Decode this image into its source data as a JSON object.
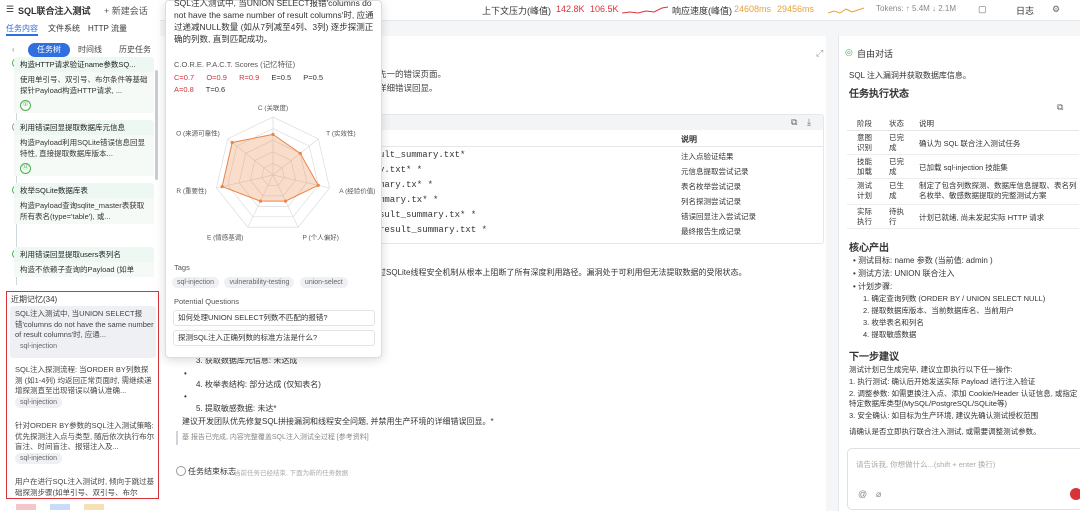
{
  "topbar": {
    "title": "SQL联合注入测试",
    "new_session": "+ 新建会话",
    "pressure_label": "上下文压力(峰值)",
    "pressure_a": "142.8K",
    "pressure_b": "106.5K",
    "speed_label": "响应速度(峰值)",
    "speed_a": "24608ms",
    "speed_b": "29456ms",
    "tokens": "Tokens: ↑ 5.4M ↓ 2.1M",
    "log": "日志",
    "colors": {
      "pressure": "#d9333a",
      "speed": "#e6a23c"
    }
  },
  "left_tabs": {
    "task": "任务内容",
    "file": "文件系统",
    "http": "HTTP 流量"
  },
  "left_pills": {
    "tree": "任务树",
    "timeline": "时间线",
    "history": "历史任务"
  },
  "task_cards": [
    {
      "head": "构造HTTP请求验证name参数SQ...",
      "body": "使用单引号、双引号、布尔条件等基础探针Payload构造HTTP请求, ...",
      "num": "①"
    },
    {
      "head": "利用错误回显提取数据库元信息",
      "body": "构造Payload利用SQLite错误信息回显特性, 直接提取数据库版本...",
      "num": "⑫"
    },
    {
      "head": "枚举SQLite数据库表",
      "body": "构造Payload查询sqlite_master表获取所有表名(type='table'), 或...",
      "num": ""
    },
    {
      "head": "利用错误回显提取users表列名",
      "body": "构造不依赖子查询的Payload (如单",
      "num": ""
    }
  ],
  "memory": {
    "title": "近期记忆(34)",
    "items": [
      {
        "text": "SQL注入测试中, 当UNION SELECT报错'columns do not have the same number of result columns'时, 应通...",
        "tag": "sql-injection"
      },
      {
        "text": "SQL注入探测流程: 当ORDER BY列数探测 (如1-4列) 均返回正常页面时, 需继续递增探测直至出现错误以确认准确...",
        "tag": "sql-injection"
      },
      {
        "text": "针对ORDER BY参数的SQL注入测试策略: 优先探测注入点与类型, 随后依次执行布尔盲注、时间盲注、报错注入及...",
        "tag": "sql-injection"
      },
      {
        "text": "用户在进行SQL注入测试时, 倾向于跳过基础探测步骤(如单引号、双引号、布尔",
        "tag": ""
      }
    ]
  },
  "popup": {
    "text": "SQL注入测试中, 当UNION SELECT报错'columns do not have the same number of result columns'时, 应通过递减NULL数量 (如从7列减至4列、3列) 逐步探测正确的列数, 直到匹配成功。",
    "scores_title": "C.O.R.E. P.A.C.T. Scores (记忆特征)",
    "scores": [
      "C=0.7",
      "O=0.9",
      "R=0.9",
      "E=0.5",
      "P=0.5",
      "A=0.8",
      "T=0.6"
    ],
    "radar_labels": [
      "C (关联度)",
      "T (实效性)",
      "A (经验价值)",
      "P (个人偏好)",
      "E (情感基调)",
      "R (重要性)",
      "O (来源可靠性)"
    ],
    "radar_values": [
      0.7,
      0.6,
      0.8,
      0.5,
      0.5,
      0.9,
      0.9
    ],
    "tags_title": "Tags",
    "tags": [
      "sql-injection",
      "vulnerability-testing",
      "union-select"
    ],
    "questions_title": "Potential Questions",
    "questions": [
      "如何处理UNION SELECT列数不匹配的报错?",
      "探测SQL注入正确列数的标准方法是什么?"
    ]
  },
  "center": {
    "line1": "先一的错误页面。",
    "line2": "详细错误回显。",
    "table_header": "说明",
    "rows": [
      {
        "file": "ult_summary.txt*",
        "desc": "注入点验证结果"
      },
      {
        "file": "y.txt* *",
        "desc": "元信息提取尝试记录"
      },
      {
        "file": "mary.tx* *",
        "desc": "表名枚举尝试记录"
      },
      {
        "file": "mmary.tx* *",
        "desc": "列名探测尝试记录"
      },
      {
        "file": "sult_summary.tx* *",
        "desc": "错误回显注入尝试记录"
      },
      {
        "file": "result_summary.txt *",
        "desc": "最终报告生成记录"
      }
    ],
    "conclusion": "过SQLite线程安全机制从根本上阻断了所有深度利用路径。漏洞处于可利用但无法提取数据的受限状态。",
    "list_items": [
      "3. 获取数据库元信息: 未达成",
      "4. 枚举表结构: 部分达成 (仅知表名)",
      "5. 提取敏感数据: 未达*"
    ],
    "advice": "建议开发团队优先修复SQL拼接漏洞和线程安全问题, 并禁用生产环境的详细错误回显。*",
    "note": "基 报告已完成, 内容完整覆盖SQL注入测试全过程 [参考资料]",
    "end_label": "任务结束标志",
    "end_hint": "当前任务已经结束, 下面为新的任务数据"
  },
  "right": {
    "title": "自由对话",
    "intro": "SQL 注入漏洞并获取数据库信息。",
    "status_title": "任务执行状态",
    "status_headers": [
      "阶段",
      "状态",
      "说明"
    ],
    "status_rows": [
      {
        "stage": "意图识别",
        "state": "已完成",
        "desc": "确认为 SQL 联合注入测试任务"
      },
      {
        "stage": "技能加载",
        "state": "已完成",
        "desc": "已加载 sql-injection 技能集"
      },
      {
        "stage": "测试计划",
        "state": "已生成",
        "desc": "制定了包含列数探测、数据库信息提取、表名列名枚举、敏感数据提取的完整测试方案"
      },
      {
        "stage": "实际执行",
        "state": "待执行",
        "desc": "计划已就绪, 尚未发起实际 HTTP 请求"
      }
    ],
    "output_title": "核心产出",
    "output_items": [
      "测试目标: name 参数 (当前值: admin )",
      "测试方法: UNION 联合注入",
      "计划步骤:"
    ],
    "steps": [
      "1. 确定查询列数 (ORDER BY / UNION SELECT NULL)",
      "2. 提取数据库版本、当前数据库名、当前用户",
      "3. 枚举表名和列名",
      "4. 提取敏感数据"
    ],
    "next_title": "下一步建议",
    "next_intro": "测试计划已生成完毕, 建议立即执行以下任一操作:",
    "next_items": [
      "1. 执行测试: 确认后开始发送实际 Payload 进行注入验证",
      "2. 调整参数: 如需更换注入点、添加 Cookie/Header 认证信息, 或指定特定数据库类型(MySQL/PostgreSQL/SQLite等)",
      "3. 安全确认: 如目标为生产环境, 建议先确认测试授权范围"
    ],
    "final": "请确认是否立即执行联合注入测试, 或需要调整测试参数。",
    "input_placeholder": "请告诉我, 你想做什么...(shift + enter 换行)"
  }
}
